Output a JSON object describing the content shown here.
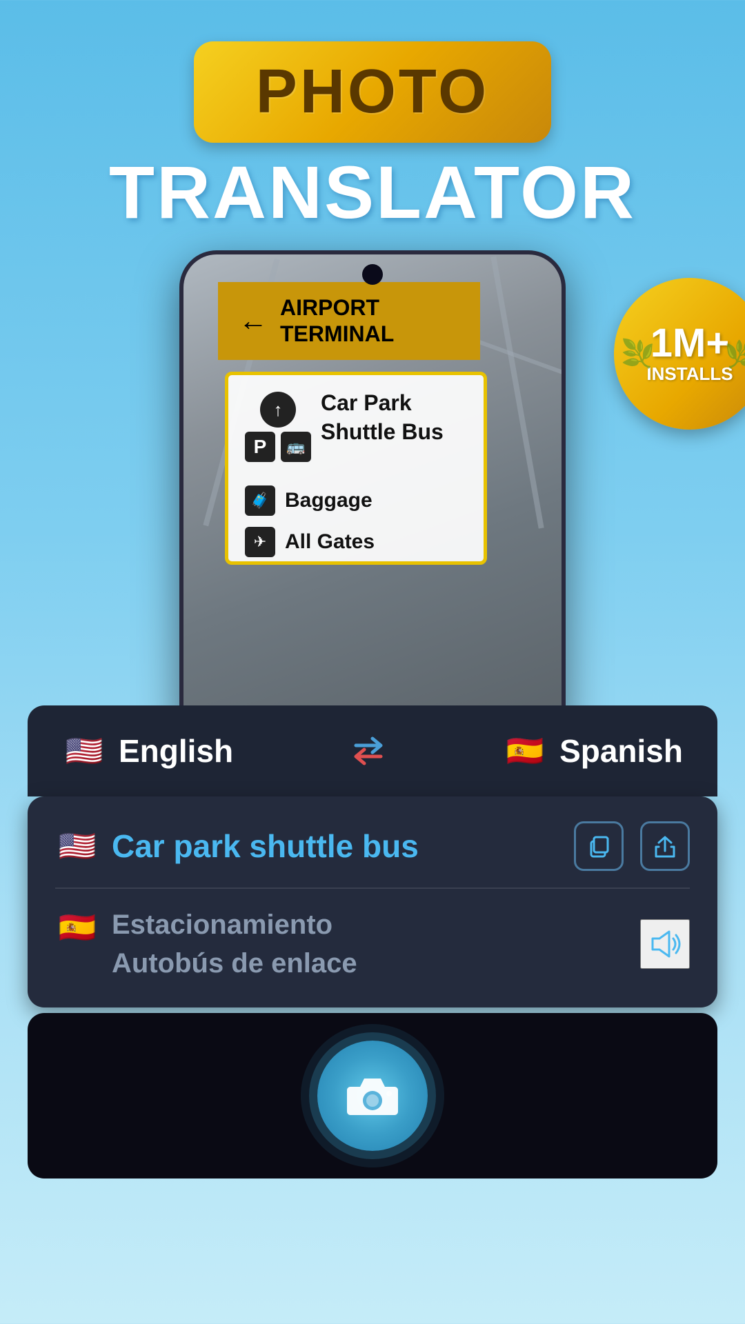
{
  "header": {
    "photo_label": "PHOTO",
    "translator_label": "TRANSLATOR"
  },
  "badge": {
    "number": "1M+",
    "label": "INSTALLS"
  },
  "sign": {
    "arrow": "←",
    "line1": "AIRPORT",
    "line2": "TERMINAL",
    "items": [
      {
        "icon": "↑",
        "text": "Car Park\nShuttle Bus"
      },
      {
        "icon": "🧳",
        "text": "Baggage"
      },
      {
        "icon": "✈",
        "text": "All Gates"
      }
    ]
  },
  "language_bar": {
    "source_flag": "🇺🇸",
    "source_label": "English",
    "swap_icon": "⇄",
    "target_flag": "🇪🇸",
    "target_label": "Spanish"
  },
  "translation": {
    "source_flag": "🇺🇸",
    "source_text": "Car park shuttle bus",
    "target_flag": "🇪🇸",
    "target_text": "Estacionamiento\nAutobús de enlace",
    "copy_icon": "⧉",
    "share_icon": "↑",
    "speaker_icon": "🔊"
  },
  "camera": {
    "button_label": "Take Photo"
  }
}
